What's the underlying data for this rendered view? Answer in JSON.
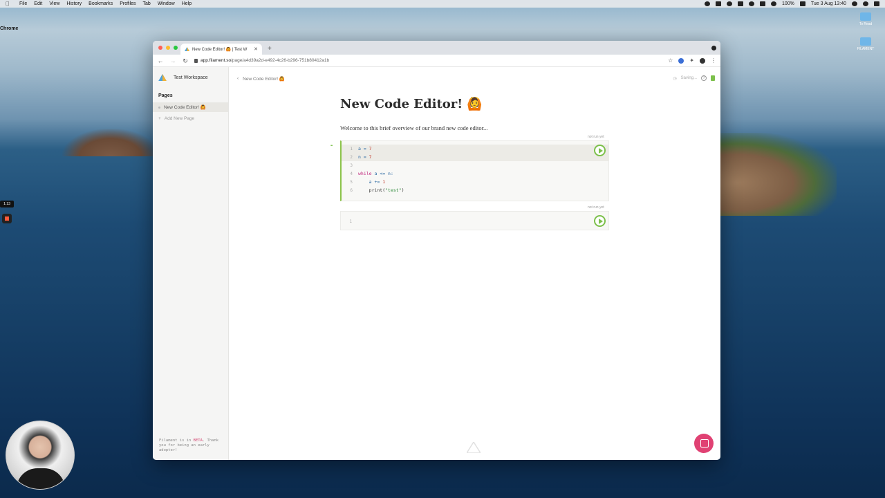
{
  "menubar": {
    "app": "Chrome",
    "items": [
      "File",
      "Edit",
      "View",
      "History",
      "Bookmarks",
      "Profiles",
      "Tab",
      "Window",
      "Help"
    ],
    "battery": "100%",
    "clock": "Tue 3 Aug  13:40"
  },
  "desktop": {
    "icons": [
      "To Read",
      "FILAMENT"
    ],
    "recording_time": "1:13"
  },
  "browser": {
    "tab_title": "New Code Editor! 🙆 | Test W",
    "url_host": "app.filament.so",
    "url_path": "/page/a4d39a2d-e492-4c26-b296-751b80412a1b"
  },
  "sidebar": {
    "workspace": "Test Workspace",
    "pages_heading": "Pages",
    "pages": [
      {
        "label": "New Code Editor! 🙆"
      }
    ],
    "add_page": "Add New Page",
    "beta_prefix": "Filament is in ",
    "beta_word": "BETA",
    "beta_suffix": ". Thank you for being an early adopter!"
  },
  "page": {
    "breadcrumb": "New Code Editor! 🙆",
    "saving": "Saving...",
    "title": "New Code Editor! 🙆",
    "intro": "Welcome to this brief overview of our brand new code editor...",
    "cells": [
      {
        "status": "not run yet",
        "lines": [
          {
            "n": "1",
            "code": "a = 7"
          },
          {
            "n": "2",
            "code": "n = 7"
          },
          {
            "n": "3",
            "code": ""
          },
          {
            "n": "4",
            "kw": "while",
            "code": " a <= n:"
          },
          {
            "n": "5",
            "code": "    a += 1"
          },
          {
            "n": "6",
            "code": "    print(\"test\")"
          }
        ]
      },
      {
        "status": "not run yet",
        "lines": [
          {
            "n": "1",
            "code": ""
          }
        ]
      }
    ]
  },
  "colors": {
    "accent_green": "#7cc04b",
    "beta_pink": "#d23c6a",
    "chat_pink": "#e04173"
  }
}
